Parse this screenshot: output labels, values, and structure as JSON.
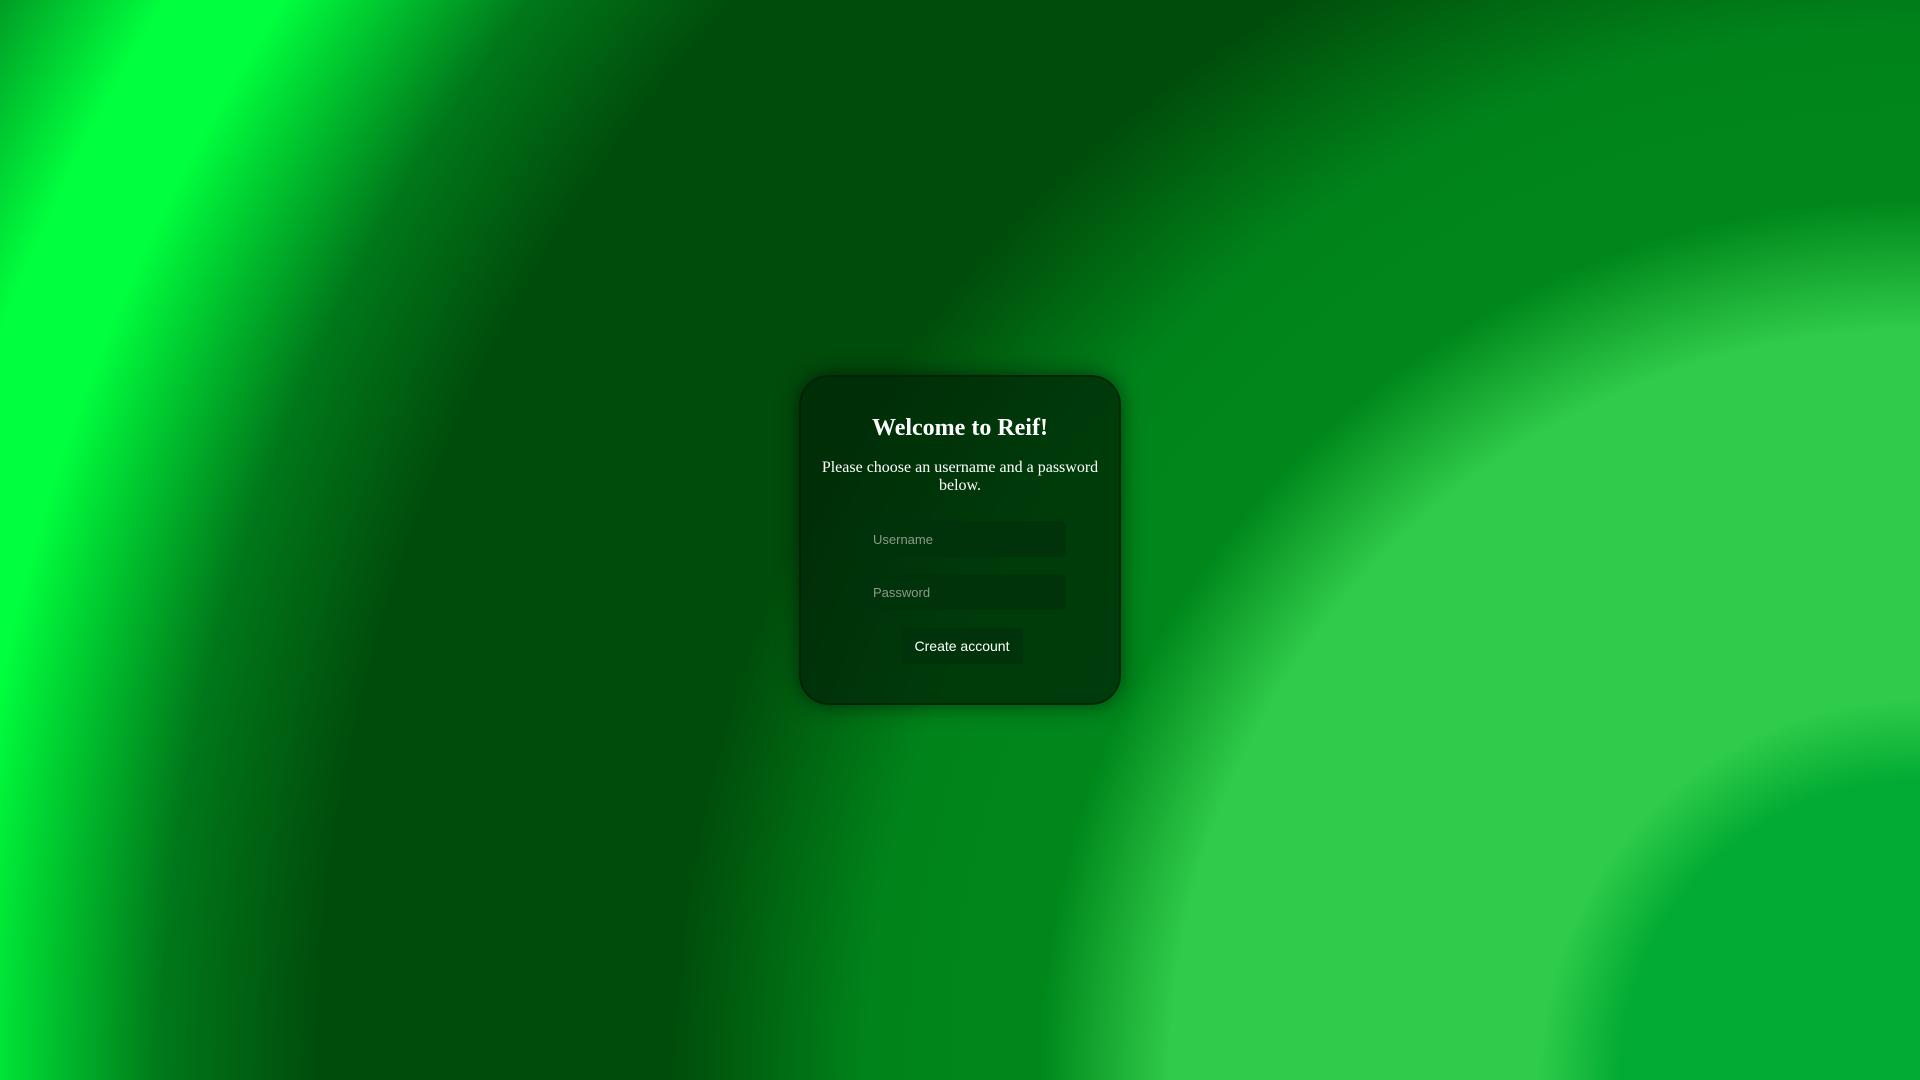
{
  "signup": {
    "title": "Welcome to Reif!",
    "subtitle": "Please choose an username and a password below.",
    "username": {
      "placeholder": "Username",
      "value": ""
    },
    "password": {
      "placeholder": "Password",
      "value": ""
    },
    "submit_label": "Create account"
  },
  "theme": {
    "background_dark": "#004c0a",
    "background_light": "#2fcb4a",
    "background_bright": "#00ff3e",
    "card_background": "#00260a",
    "input_background": "#00330a",
    "text_color": "#ffffff"
  }
}
